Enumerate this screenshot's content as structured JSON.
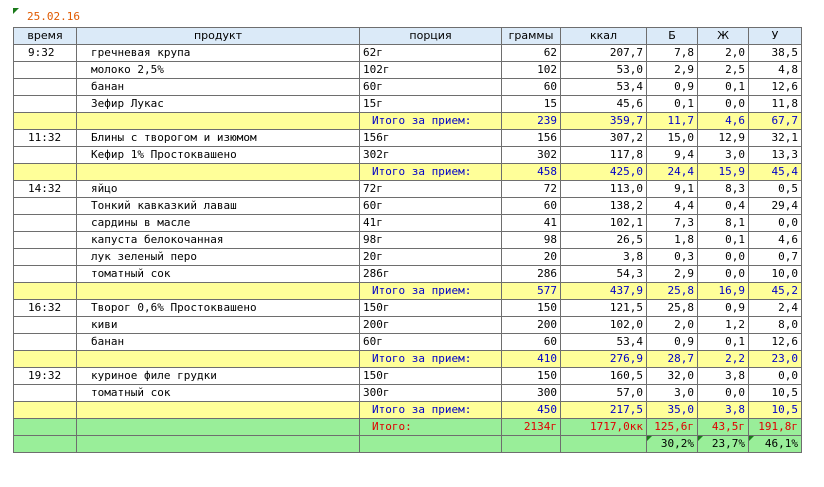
{
  "date": "25.02.16",
  "headers": [
    "время",
    "продукт",
    "порция",
    "граммы",
    "ккал",
    "Б",
    "Ж",
    "У"
  ],
  "meals": [
    {
      "items": [
        {
          "time": "9:32",
          "product": "гречневая крупа",
          "portion": "62г",
          "grams": "62",
          "kcal": "207,7",
          "b": "7,8",
          "zh": "2,0",
          "u": "38,5"
        },
        {
          "time": "",
          "product": "молоко 2,5%",
          "portion": "102г",
          "grams": "102",
          "kcal": "53,0",
          "b": "2,9",
          "zh": "2,5",
          "u": "4,8"
        },
        {
          "time": "",
          "product": "банан",
          "portion": "60г",
          "grams": "60",
          "kcal": "53,4",
          "b": "0,9",
          "zh": "0,1",
          "u": "12,6"
        },
        {
          "time": "",
          "product": "Зефир Лукас",
          "portion": "15г",
          "grams": "15",
          "kcal": "45,6",
          "b": "0,1",
          "zh": "0,0",
          "u": "11,8"
        }
      ],
      "subtotal": {
        "label": "Итого за прием:",
        "grams": "239",
        "kcal": "359,7",
        "b": "11,7",
        "zh": "4,6",
        "u": "67,7"
      }
    },
    {
      "items": [
        {
          "time": "11:32",
          "product": "Блины с творогом и изюмом",
          "portion": "156г",
          "grams": "156",
          "kcal": "307,2",
          "b": "15,0",
          "zh": "12,9",
          "u": "32,1"
        },
        {
          "time": "",
          "product": "Кефир 1% Простоквашено",
          "portion": "302г",
          "grams": "302",
          "kcal": "117,8",
          "b": "9,4",
          "zh": "3,0",
          "u": "13,3"
        }
      ],
      "subtotal": {
        "label": "Итого за прием:",
        "grams": "458",
        "kcal": "425,0",
        "b": "24,4",
        "zh": "15,9",
        "u": "45,4"
      }
    },
    {
      "items": [
        {
          "time": "14:32",
          "product": "яйцо",
          "portion": "72г",
          "grams": "72",
          "kcal": "113,0",
          "b": "9,1",
          "zh": "8,3",
          "u": "0,5"
        },
        {
          "time": "",
          "product": "Тонкий кавказкий лаваш",
          "portion": "60г",
          "grams": "60",
          "kcal": "138,2",
          "b": "4,4",
          "zh": "0,4",
          "u": "29,4"
        },
        {
          "time": "",
          "product": "сардины в масле",
          "portion": "41г",
          "grams": "41",
          "kcal": "102,1",
          "b": "7,3",
          "zh": "8,1",
          "u": "0,0"
        },
        {
          "time": "",
          "product": "капуста белокочанная",
          "portion": "98г",
          "grams": "98",
          "kcal": "26,5",
          "b": "1,8",
          "zh": "0,1",
          "u": "4,6"
        },
        {
          "time": "",
          "product": "лук зеленый перо",
          "portion": "20г",
          "grams": "20",
          "kcal": "3,8",
          "b": "0,3",
          "zh": "0,0",
          "u": "0,7"
        },
        {
          "time": "",
          "product": "томатный сок",
          "portion": "286г",
          "grams": "286",
          "kcal": "54,3",
          "b": "2,9",
          "zh": "0,0",
          "u": "10,0"
        }
      ],
      "subtotal": {
        "label": "Итого за прием:",
        "grams": "577",
        "kcal": "437,9",
        "b": "25,8",
        "zh": "16,9",
        "u": "45,2"
      }
    },
    {
      "items": [
        {
          "time": "16:32",
          "product": "Творог 0,6% Простоквашено",
          "portion": "150г",
          "grams": "150",
          "kcal": "121,5",
          "b": "25,8",
          "zh": "0,9",
          "u": "2,4"
        },
        {
          "time": "",
          "product": "киви",
          "portion": "200г",
          "grams": "200",
          "kcal": "102,0",
          "b": "2,0",
          "zh": "1,2",
          "u": "8,0"
        },
        {
          "time": "",
          "product": "банан",
          "portion": "60г",
          "grams": "60",
          "kcal": "53,4",
          "b": "0,9",
          "zh": "0,1",
          "u": "12,6"
        }
      ],
      "subtotal": {
        "label": "Итого за прием:",
        "grams": "410",
        "kcal": "276,9",
        "b": "28,7",
        "zh": "2,2",
        "u": "23,0"
      }
    },
    {
      "items": [
        {
          "time": "19:32",
          "product": "куриное филе грудки",
          "portion": "150г",
          "grams": "150",
          "kcal": "160,5",
          "b": "32,0",
          "zh": "3,8",
          "u": "0,0"
        },
        {
          "time": "",
          "product": "томатный сок",
          "portion": "300г",
          "grams": "300",
          "kcal": "57,0",
          "b": "3,0",
          "zh": "0,0",
          "u": "10,5"
        }
      ],
      "subtotal": {
        "label": "Итого за прием:",
        "grams": "450",
        "kcal": "217,5",
        "b": "35,0",
        "zh": "3,8",
        "u": "10,5"
      }
    }
  ],
  "total": {
    "label": "Итого:",
    "grams": "2134г",
    "kcal": "1717,0кк",
    "b": "125,6г",
    "zh": "43,5г",
    "u": "191,8г"
  },
  "percent": {
    "b": "30,2%",
    "zh": "23,7%",
    "u": "46,1%"
  }
}
